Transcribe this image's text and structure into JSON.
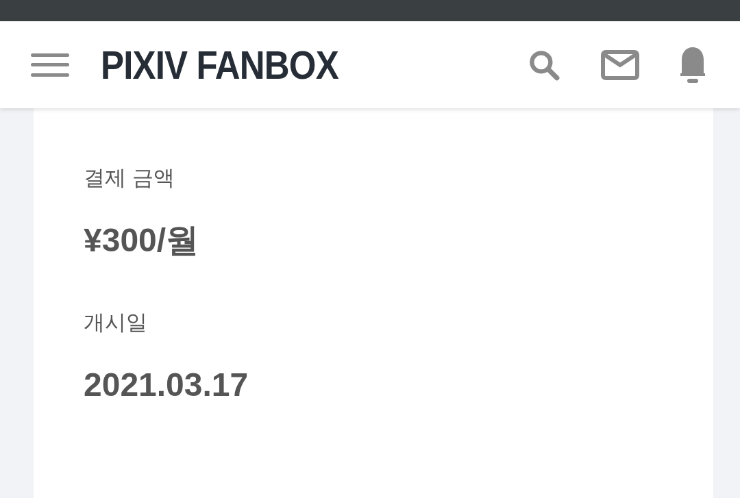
{
  "header": {
    "logo": "PIXIV FANBOX"
  },
  "details": [
    {
      "label": "결제 금액",
      "value": "¥300/월"
    },
    {
      "label": "개시일",
      "value": "2021.03.17"
    }
  ]
}
